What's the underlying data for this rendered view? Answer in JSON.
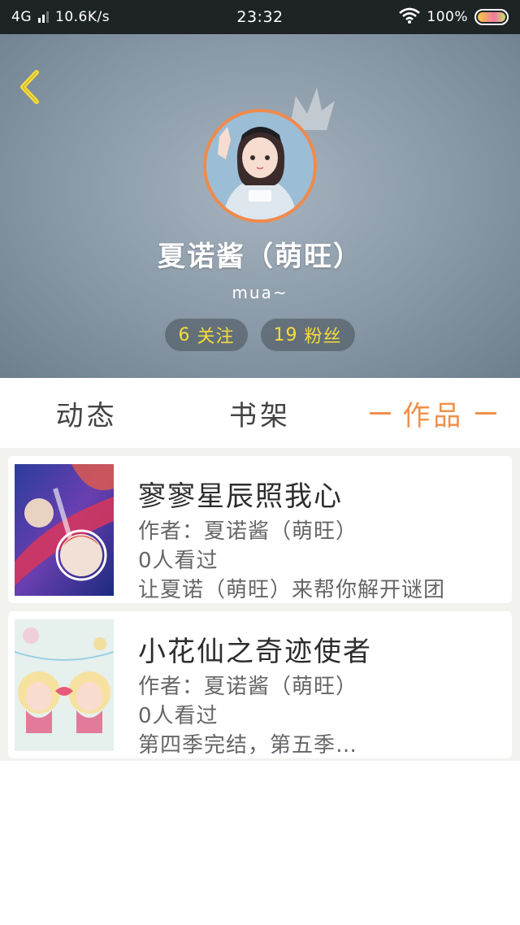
{
  "status_bar": {
    "network": "4G",
    "speed": "10.6K/s",
    "time": "23:32",
    "battery": "100%"
  },
  "profile": {
    "name": "夏诺酱（萌旺）",
    "bio": "mua~",
    "following_count": "6",
    "following_label": "关注",
    "followers_count": "19",
    "followers_label": "粉丝",
    "avatar_border_color": "#f08a4b"
  },
  "tabs": [
    {
      "label": "动态",
      "active": false
    },
    {
      "label": "书架",
      "active": false
    },
    {
      "label": "作品",
      "active": true
    }
  ],
  "colors": {
    "accent": "#f0904a",
    "stat_text": "#f7dc3a"
  },
  "books": [
    {
      "title": "寥寥星辰照我心",
      "author": "作者：夏诺酱（萌旺）",
      "views": "0人看过",
      "desc": "让夏诺（萌旺）来帮你解开谜团"
    },
    {
      "title": "小花仙之奇迹使者",
      "author": "作者：夏诺酱（萌旺）",
      "views": "0人看过",
      "desc": "第四季完结，第五季…"
    }
  ]
}
